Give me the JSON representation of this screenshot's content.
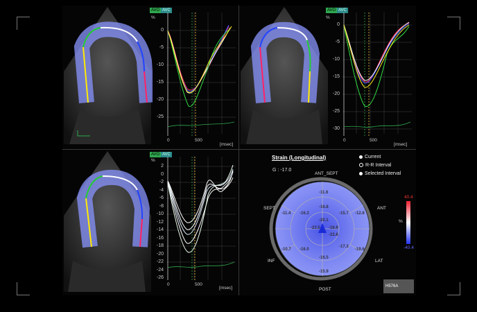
{
  "graph_tags": {
    "avo": "AVO",
    "avc": "AVC"
  },
  "units": {
    "percent": "%",
    "time": "msec"
  },
  "top_left_graph": {
    "y_ticks": [
      "0",
      "-5",
      "-10",
      "-15",
      "-20",
      "-25"
    ],
    "x_ticks": [
      "0",
      "500"
    ]
  },
  "top_right_graph": {
    "y_ticks": [
      "0",
      "-5",
      "-10",
      "-15",
      "-20",
      "-25",
      "-30"
    ],
    "x_ticks": [
      "0",
      "500"
    ]
  },
  "bottom_left_graph": {
    "y_ticks": [
      "2",
      "0",
      "-2",
      "-4",
      "-6",
      "-8",
      "-10",
      "-12",
      "-14",
      "-16",
      "-18",
      "-20",
      "-22",
      "-24",
      "-26"
    ],
    "x_ticks": [
      "0",
      "500"
    ]
  },
  "bullseye": {
    "title": "Strain (Longitudinal)",
    "global_label": "G : -17.0",
    "legend": [
      "Current",
      "R-R Interval",
      "Selected Interval"
    ],
    "wall_labels": {
      "ant_sept": "ANT_SEPT",
      "sept": "SEPT",
      "ant": "ANT",
      "inf": "INF",
      "lat": "LAT",
      "post": "POST"
    },
    "segment_values": {
      "outer": [
        "-11.6",
        "-12.8",
        "-19.6",
        "-15.9",
        "-10.7",
        "-11.4"
      ],
      "mid": [
        "-16.8",
        "-15.7",
        "-17.3",
        "-16.5",
        "-16.0",
        "-16.2"
      ],
      "inner": [
        "-20.1",
        "-18.8",
        "-22.8",
        "-23.5"
      ]
    }
  },
  "colorbar": {
    "max": "40.4",
    "unit": "%",
    "min": "-40.4"
  },
  "model_label": "H576A",
  "colors": {
    "accent_green": "#2fa84f",
    "strain_fill": "#7c86f2"
  }
}
